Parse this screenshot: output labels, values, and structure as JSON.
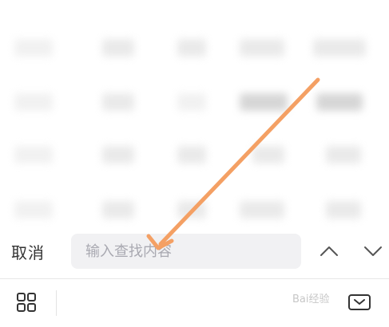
{
  "search": {
    "cancel_label": "取消",
    "placeholder": "输入查找内容"
  },
  "icons": {
    "up": "chevron-up-icon",
    "down": "chevron-down-icon",
    "grid": "grid-icon",
    "keyboard": "keyboard-hide-icon"
  },
  "colors": {
    "arrow": "#f4a064",
    "input_bg": "#f1f1f3",
    "text": "#333333",
    "placeholder": "#a9a9b1"
  },
  "watermark": "Bai经验"
}
